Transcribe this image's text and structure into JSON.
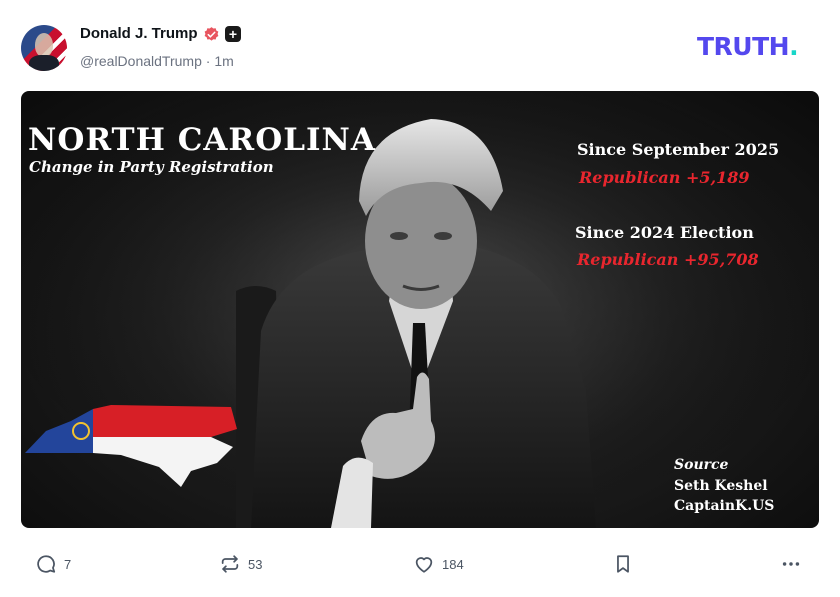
{
  "post": {
    "author": {
      "display_name": "Donald J. Trump",
      "handle": "@realDonaldTrump",
      "time_ago": "1m",
      "separator": "·"
    },
    "brand": {
      "logo_text": "TRUTH",
      "logo_dot": ".",
      "logo_color": "#5448ee",
      "dot_color": "#17d6c8"
    },
    "image": {
      "title": "NORTH CAROLINA",
      "subtitle": "Change in Party Registration",
      "stat1_label": "Since September 2025",
      "stat1_value": "Republican +5,189",
      "stat2_label": "Since 2024 Election",
      "stat2_value": "Republican +95,708",
      "source_heading": "Source",
      "source_name": "Seth Keshel",
      "source_site": "CaptainK.US",
      "accent_red": "#e8262e"
    },
    "actions": {
      "reply_count": "7",
      "retruth_count": "53",
      "like_count": "184"
    },
    "icons": [
      "verified-icon",
      "plus-icon",
      "reply-icon",
      "retruth-icon",
      "heart-icon",
      "bookmark-icon",
      "more-icon"
    ]
  }
}
